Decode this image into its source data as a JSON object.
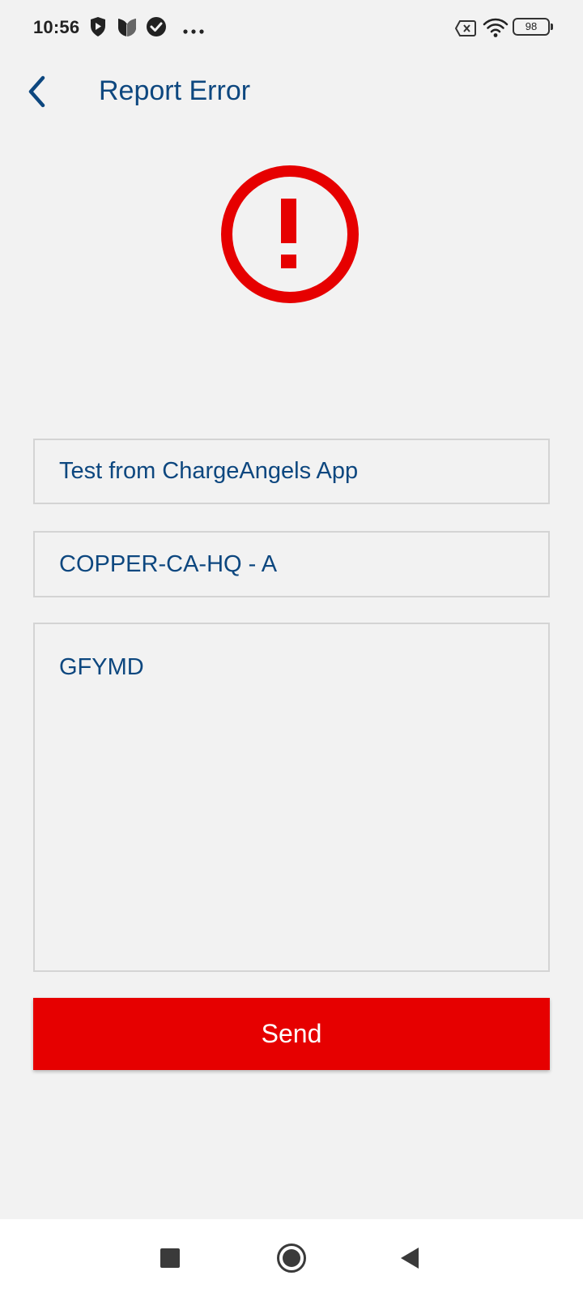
{
  "status_bar": {
    "time": "10:56",
    "battery": "98",
    "icons": [
      "shield-play-icon",
      "tulip-icon",
      "check-circle-icon",
      "more-dots-icon",
      "sim-off-icon",
      "wifi-icon",
      "battery-icon"
    ]
  },
  "header": {
    "title": "Report Error",
    "back_icon": "chevron-left-icon"
  },
  "error_icon": {
    "name": "error-exclamation-icon",
    "color": "#e60000"
  },
  "form": {
    "subject_value": "Test from ChargeAngels App",
    "location_value": "COPPER-CA-HQ - A",
    "message_value": "GFYMD",
    "send_label": "Send"
  },
  "nav_bar": {
    "items": [
      "recent-apps-icon",
      "home-icon",
      "back-triangle-icon"
    ]
  },
  "colors": {
    "accent": "#e60000",
    "primary_text": "#0d477f",
    "background": "#f2f2f2",
    "field_border": "#d4d4d4"
  }
}
